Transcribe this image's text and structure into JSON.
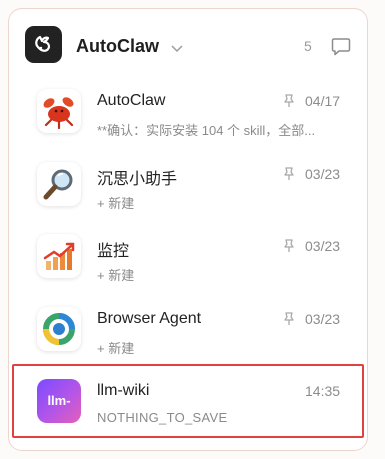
{
  "header": {
    "title": "AutoClaw",
    "count": "5",
    "logo_icon": "claw-logo-icon",
    "chevron_icon": "chevron-down-icon",
    "chat_icon": "chat-bubble-icon"
  },
  "colors": {
    "highlight_border": "#e0433f",
    "panel_border": "#ecd6cb",
    "llm_gradient_start": "#7a4bff",
    "llm_gradient_end": "#e45fb8"
  },
  "items": [
    {
      "name": "AutoClaw",
      "time": "04/17",
      "pinned": true,
      "preview": "**确认：实际安装 104 个 skill，全部...",
      "icon": "lobster-icon"
    },
    {
      "name": "沉思小助手",
      "time": "03/23",
      "pinned": true,
      "preview": "+ 新建",
      "icon": "magnifier-icon"
    },
    {
      "name": "监控",
      "time": "03/23",
      "pinned": true,
      "preview": "+ 新建",
      "icon": "growth-chart-icon"
    },
    {
      "name": "Browser Agent",
      "time": "03/23",
      "pinned": true,
      "preview": "+ 新建",
      "icon": "browser-ring-icon"
    },
    {
      "name": "llm-wiki",
      "time": "14:35",
      "pinned": false,
      "preview": "NOTHING_TO_SAVE",
      "avatar_text": "llm-",
      "icon": "llm-wiki-avatar"
    }
  ]
}
